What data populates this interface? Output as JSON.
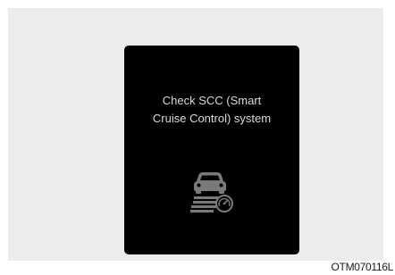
{
  "display": {
    "message": "Check SCC (Smart\nCruise Control) system",
    "icon": "scc-warning-icon",
    "text_color": "#d8d8d8",
    "background_color": "#000000"
  },
  "caption": "OTM070116L"
}
